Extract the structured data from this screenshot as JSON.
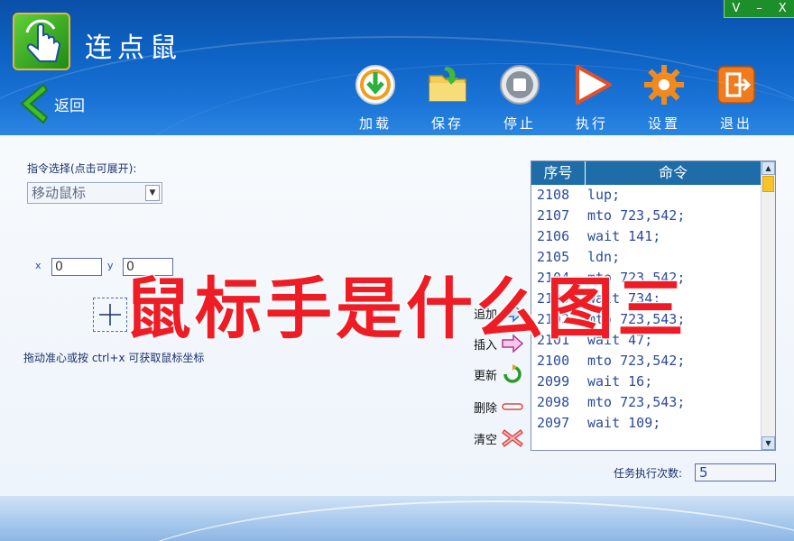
{
  "app": {
    "title": "连点鼠"
  },
  "window_controls": [
    "V",
    "–",
    "X"
  ],
  "back": {
    "label": "返回"
  },
  "toolbar": [
    {
      "label": "加载",
      "icon": "load-icon"
    },
    {
      "label": "保存",
      "icon": "save-folder-icon"
    },
    {
      "label": "停止",
      "icon": "stop-icon"
    },
    {
      "label": "执行",
      "icon": "play-icon"
    },
    {
      "label": "设置",
      "icon": "gear-icon"
    },
    {
      "label": "退出",
      "icon": "exit-icon"
    }
  ],
  "command_select": {
    "label": "指令选择(点击可展开):",
    "value": "移动鼠标"
  },
  "coords": {
    "x_label": "x",
    "x_value": "0",
    "y_label": "y",
    "y_value": "0"
  },
  "hint": "拖动准心或按 ctrl+x 可获取鼠标坐标",
  "actions": [
    {
      "label": "追加",
      "icon": "append-arrow-icon"
    },
    {
      "label": "插入",
      "icon": "insert-arrow-icon"
    },
    {
      "label": "更新",
      "icon": "refresh-icon"
    },
    {
      "label": "删除",
      "icon": "delete-minus-icon"
    },
    {
      "label": "清空",
      "icon": "clear-x-icon"
    }
  ],
  "command_list": {
    "headers": [
      "序号",
      "命令"
    ],
    "rows": [
      {
        "n": "2108",
        "c": "lup;"
      },
      {
        "n": "2107",
        "c": "mto 723,542;"
      },
      {
        "n": "2106",
        "c": "wait 141;"
      },
      {
        "n": "2105",
        "c": "ldn;"
      },
      {
        "n": "2104",
        "c": "mto 723,542;"
      },
      {
        "n": "2103",
        "c": "wait 734;"
      },
      {
        "n": "2102",
        "c": "mto 723,543;"
      },
      {
        "n": "2101",
        "c": "wait 47;"
      },
      {
        "n": "2100",
        "c": "mto 723,542;"
      },
      {
        "n": "2099",
        "c": "wait 16;"
      },
      {
        "n": "2098",
        "c": "mto 723,543;"
      },
      {
        "n": "2097",
        "c": "wait 109;"
      }
    ]
  },
  "task": {
    "label": "任务执行次数:",
    "value": "5"
  },
  "watermark": "鼠标手是什么图三"
}
